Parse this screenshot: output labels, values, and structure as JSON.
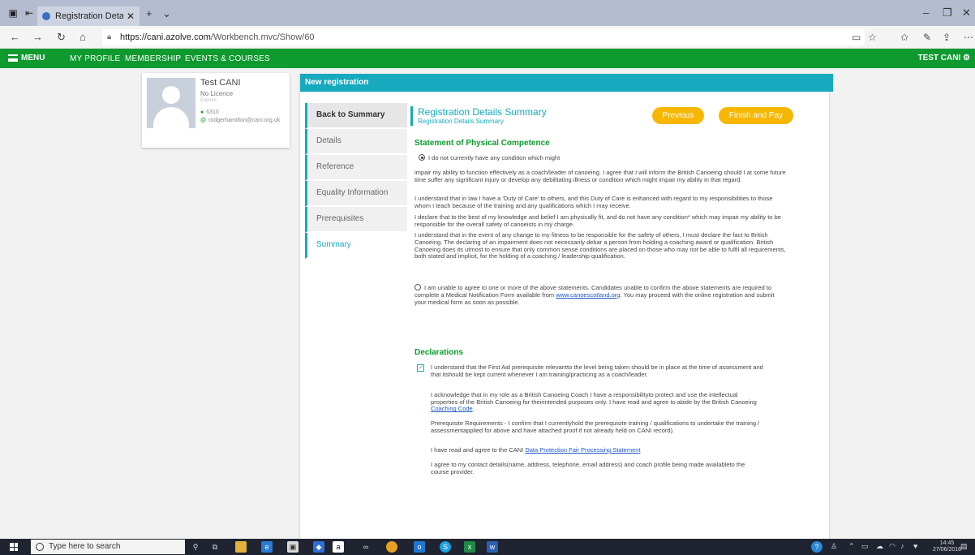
{
  "browser": {
    "tab_title": "Registration Details - Gr",
    "url_host": "https://cani.azolve.com",
    "url_path": "/Workbench.mvc/Show/60"
  },
  "appnav": {
    "menu": "MENU",
    "items": [
      "MY PROFILE",
      "MEMBERSHIP",
      "EVENTS & COURSES"
    ],
    "user": "TEST CANI"
  },
  "profile": {
    "name": "Test CANI",
    "licence": "No Licence",
    "expires": "Expires",
    "id": "6310",
    "email": "rodgerhamilton@cani.org.uk"
  },
  "panel": {
    "header": "New registration",
    "side_items": [
      "Back to Summary",
      "Details",
      "Reference",
      "Equality Information",
      "Prerequisites",
      "Summary"
    ],
    "title": "Registration Details Summary",
    "subtitle": "Registration Details Summary",
    "btn_previous": "Previous",
    "btn_pay": "Finish and Pay"
  },
  "competence": {
    "heading": "Statement of Physical Competence",
    "radio1": "I do not currently have any condition which might",
    "p1": "impair my ability to function effectively as a coach/leader of canoeing. I agree that I will inform the British Canoeing should I at some future time suffer any significant injury or develop any debilitating illness or condition which might impair my ability in that regard.",
    "p2": "I understand that in law I have a 'Duty of Care' to others, and this Duty of Care is enhanced with regard to my responsibilities to those whom I teach because of the training and any qualifications which I may receive.",
    "p3": "I declare that to the best of my knowledge and belief I am physically fit, and do not have any condition* which may impair my ability to be responsible for the overall safety of canoeists in my charge.",
    "p4": "I understand that in the event of any change to my fitness to be responsible for the safety of others, I must declare the fact to British Canoeing. The declaring of an impairment does not necessarily debar a person from holding a coaching award or qualification. British Canoeing does its utmost to ensure that only common sense conditions are placed on those who may not be able to fulfil all requirements, both stated and implicit, for the holding of a coaching / leadership qualification.",
    "radio2_a": "I am unable to agree to one or more of the above statements. Candidates unable to confirm the above statements are required to complete a Medical Notification Form available from",
    "radio2_link": "www.canoescotland.org",
    "radio2_b": ". You may proceed with the online registration and submit your medical form as soon as possible."
  },
  "declarations": {
    "heading": "Declarations",
    "d1": "I understand that the First Aid prerequisite relevantto the level being taken should be in place at the time of assessment and that itshould be kept current whenever I am training/practicing as a coach/leader.",
    "d2_a": "I acknowledge that in my role as a British Canoeing Coach I have a responsibilityto protect and use the intellectual properties of the British Canoeing for theirintended purposes only. I have read and agree to abide by the British Canoeing",
    "d2_link": "Coaching Code",
    "d3": "Prerequisite Requirements - I confirm that I currentlyhold the prerequisite training / qualifications to undertake the training / assessmentapplied for above and have attached proof if not already held on CANI record).",
    "d4_a": "I have read and agree to the CANI",
    "d4_link": "Data Protection Fair Processing Statement",
    "d5": "I agree to my contact details(name, address, telephone, email address) and coach profile being made availableto the course provider."
  },
  "taskbar": {
    "search_placeholder": "Type here to search",
    "time": "14:45",
    "date": "27/06/2018"
  }
}
